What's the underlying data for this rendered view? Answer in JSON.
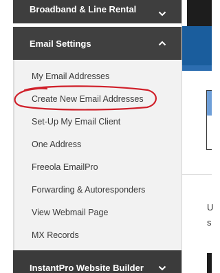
{
  "sidebar": {
    "broadband": {
      "label": "Broadband & Line Rental",
      "icon": "chevron-down-icon"
    },
    "email": {
      "label": "Email Settings",
      "icon": "chevron-up-icon"
    },
    "items": [
      {
        "label": "My Email Addresses"
      },
      {
        "label": "Create New Email Addresses"
      },
      {
        "label": "Set-Up My Email Client"
      },
      {
        "label": "One Address"
      },
      {
        "label": "Freeola EmailPro"
      },
      {
        "label": "Forwarding & Autoresponders"
      },
      {
        "label": "View Webmail Page"
      },
      {
        "label": "MX Records"
      }
    ],
    "instantpro": {
      "label": "InstantPro Website Builder",
      "icon": "chevron-down-icon"
    }
  },
  "right_panel": {
    "text_line1": "U",
    "text_line2": "s"
  },
  "annotation": {
    "color": "#d0202a",
    "highlighted_item": "Create New Email Addresses"
  },
  "colors": {
    "header_bg": "#3e3e3e",
    "submenu_bg": "#f2f2f2",
    "accent_blue": "#1a5d9d"
  }
}
